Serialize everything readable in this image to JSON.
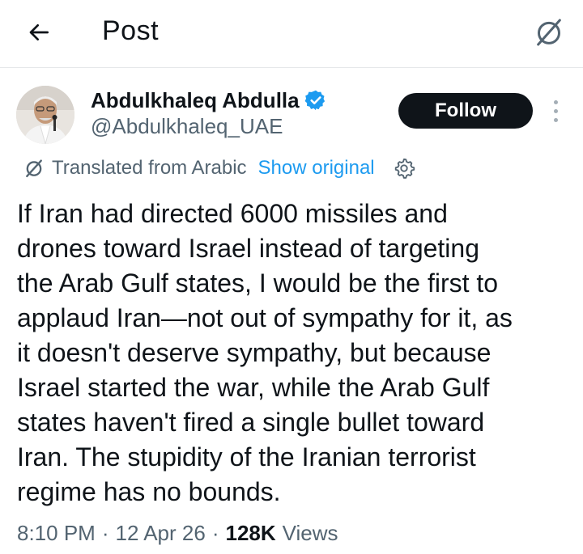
{
  "header": {
    "title": "Post",
    "back_icon": "arrow-left-icon",
    "translate_icon": "translate-slash-icon"
  },
  "author": {
    "name": "Abdulkhaleq Abdulla",
    "handle": "@Abdulkhaleq_UAE",
    "verified": true,
    "verified_color": "#1d9bf0",
    "follow_label": "Follow"
  },
  "translation": {
    "label": "Translated from Arabic",
    "show_original": "Show original"
  },
  "post": {
    "text": "If Iran had directed 6000 missiles and\ndrones toward Israel instead of targeting\nthe Arab Gulf states, I would be the first to\napplaud Iran—not out of sympathy for it, as\nit doesn't deserve sympathy, but because\nIsrael started the war, while the Arab Gulf\nstates haven't fired a single bullet toward\nIran. The stupidity of the Iranian terrorist\nregime has no bounds."
  },
  "meta": {
    "time": "8:10 PM",
    "date": "12 Apr 26",
    "separator": "·",
    "views_count": "128K",
    "views_label": "Views"
  },
  "colors": {
    "text": "#0f1419",
    "muted": "#536471",
    "link": "#1d9bf0",
    "follow_bg": "#0f1419"
  }
}
